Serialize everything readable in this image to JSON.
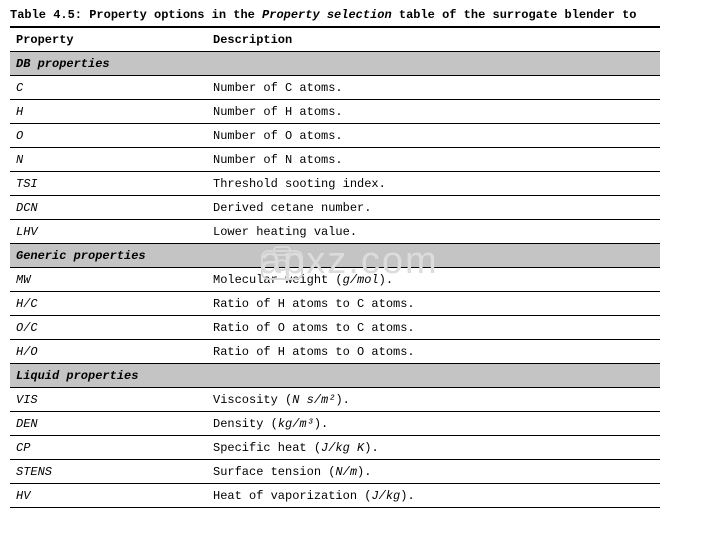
{
  "caption": {
    "prefix": "Table 4.5: Property options in the ",
    "italic": "Property selection",
    "suffix": " table of the surrogate blender to"
  },
  "headers": {
    "property": "Property",
    "description": "Description"
  },
  "sections": {
    "db": "DB properties",
    "generic": "Generic properties",
    "liquid": "Liquid properties"
  },
  "rows": {
    "c": {
      "prop": "C",
      "desc": "Number of C atoms."
    },
    "h": {
      "prop": "H",
      "desc": "Number of H atoms."
    },
    "o": {
      "prop": "O",
      "desc": "Number of O atoms."
    },
    "n": {
      "prop": "N",
      "desc": "Number of N atoms."
    },
    "tsi": {
      "prop": "TSI",
      "desc": "Threshold sooting index."
    },
    "dcn": {
      "prop": "DCN",
      "desc": "Derived cetane number."
    },
    "lhv": {
      "prop": "LHV",
      "desc": "Lower heating value."
    },
    "mw": {
      "prop": "MW",
      "desc_pre": "Molecular weight (",
      "units": "g/mol",
      "desc_post": ")."
    },
    "hc": {
      "prop": "H/C",
      "desc": "Ratio of H atoms to C atoms."
    },
    "oc": {
      "prop": "O/C",
      "desc": "Ratio of O atoms to C atoms."
    },
    "ho": {
      "prop": "H/O",
      "desc": "Ratio of H atoms to O atoms."
    },
    "vis": {
      "prop": "VIS",
      "desc_pre": "Viscosity (",
      "units": "N s/m²",
      "desc_post": ")."
    },
    "den": {
      "prop": "DEN",
      "desc_pre": "Density (",
      "units": "kg/m³",
      "desc_post": ")."
    },
    "cp": {
      "prop": "CP",
      "desc_pre": "Specific heat (",
      "units": "J/kg K",
      "desc_post": ")."
    },
    "stens": {
      "prop": "STENS",
      "desc_pre": "Surface tension (",
      "units": "N/m",
      "desc_post": ")."
    },
    "hv": {
      "prop": "HV",
      "desc_pre": "Heat of vaporization (",
      "units": "J/kg",
      "desc_post": ")."
    }
  },
  "watermark": "apxz.com"
}
